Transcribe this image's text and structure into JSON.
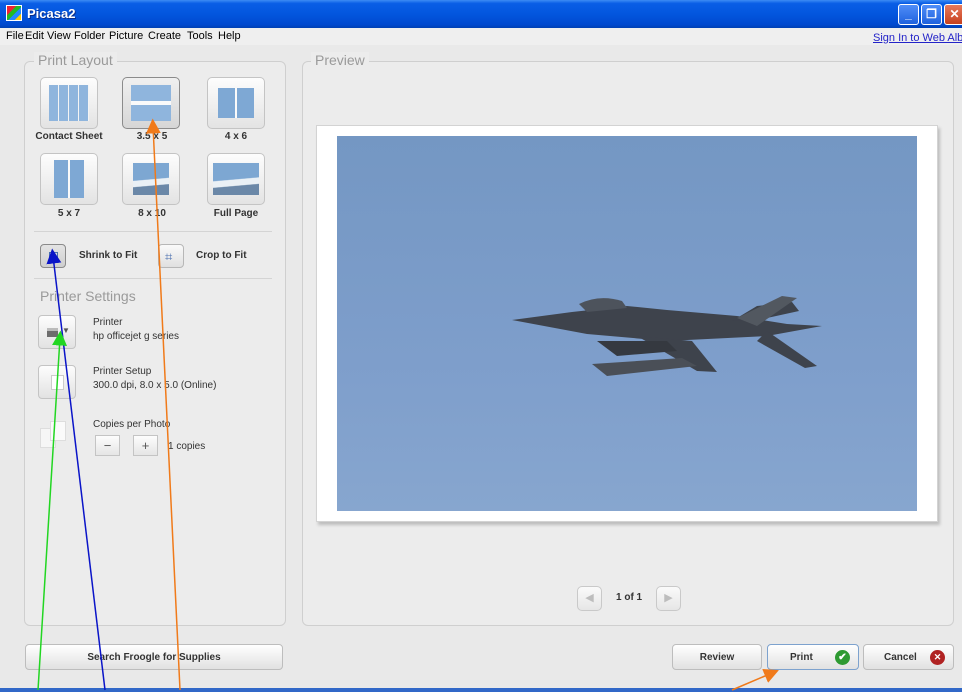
{
  "window": {
    "title": "Picasa2",
    "minimize": "_",
    "maximize": "❐",
    "close": "✕"
  },
  "menu": [
    "File",
    "Edit",
    "View",
    "Folder",
    "Picture",
    "Create",
    "Tools",
    "Help"
  ],
  "sign_in": "Sign In to Web Album",
  "print_layout": {
    "title": "Print Layout",
    "options": [
      "Contact Sheet",
      "3.5 x 5",
      "4 x 6",
      "5 x 7",
      "8 x 10",
      "Full Page"
    ],
    "selected": "3.5 x 5"
  },
  "fit": {
    "shrink": "Shrink to Fit",
    "crop": "Crop to Fit",
    "selected": "Shrink to Fit"
  },
  "printer_settings": {
    "title": "Printer Settings",
    "printer_label": "Printer",
    "printer_value": "hp officejet g series",
    "setup_label": "Printer Setup",
    "setup_value": "300.0 dpi, 8.0 x 5.0 (Online)",
    "copies_label": "Copies per Photo",
    "minus": "−",
    "plus": "+",
    "copies_value": "1 copies"
  },
  "search_button": "Search Froogle for Supplies",
  "preview": {
    "title": "Preview",
    "page_indicator": "1 of 1",
    "prev_glyph": "◀",
    "next_glyph": "▶"
  },
  "buttons": {
    "review": "Review",
    "print": "Print",
    "cancel": "Cancel"
  },
  "colors": {
    "title_bar": "#0356de",
    "sky": "#7e9ecb",
    "arrow_orange": "#f07a1a",
    "arrow_blue": "#0a14c8",
    "arrow_green": "#22d622",
    "check_green": "#2e9a32",
    "cancel_red": "#b02222"
  }
}
